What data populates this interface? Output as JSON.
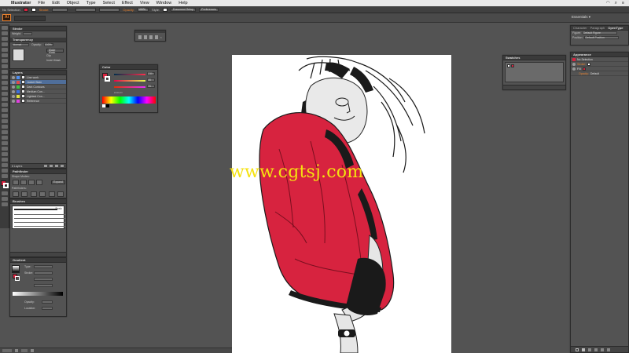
{
  "menubar": {
    "app_name": "Illustrator",
    "items": [
      "File",
      "Edit",
      "Object",
      "Type",
      "Select",
      "Effect",
      "View",
      "Window",
      "Help"
    ]
  },
  "controlbar": {
    "selection_label": "No Selection",
    "stroke_label": "Stroke:",
    "opacity_label": "Opacity:",
    "opacity_value": "100%",
    "style_label": "Style:",
    "document_setup": "Document Setup",
    "preferences": "Preferences"
  },
  "app": {
    "logo": "Ai",
    "workspace": "Essentials ▾"
  },
  "stroke_panel": {
    "title": "Stroke",
    "weight_label": "Weight:"
  },
  "transparency_panel": {
    "title": "Transparency",
    "blend_mode": "Normal",
    "opacity_label": "Opacity:",
    "opacity_value": "100%",
    "make_mask": "Make Mask",
    "clip": "Clip",
    "invert_mask": "Invert Mask"
  },
  "layers_panel": {
    "title": "Layers",
    "footer": "6 Layers",
    "layers": [
      {
        "name": "Line work",
        "color": "#4f8ff0"
      },
      {
        "name": "Jacket Stain",
        "color": "#e04a4a"
      },
      {
        "name": "Dark Contours",
        "color": "#3fc43f"
      },
      {
        "name": "Medium Con...",
        "color": "#3c6fe0"
      },
      {
        "name": "Lightest Con...",
        "color": "#e0e040"
      },
      {
        "name": "Reference",
        "color": "#e040e0"
      }
    ]
  },
  "pathfinder_panel": {
    "title": "Pathfinder",
    "shape_modes": "Shape Modes:",
    "expand": "Expand",
    "pathfinders": "Pathfinders:"
  },
  "brushes_panel": {
    "title": "Brushes",
    "basic": "Basic"
  },
  "gradient_panel": {
    "title": "Gradient",
    "type_label": "Type:",
    "stroke_label": "Stroke:",
    "opacity_label": "Opacity:",
    "location_label": "Location:"
  },
  "color_panel": {
    "title": "Color",
    "r": "230",
    "g": "46",
    "b": "76",
    "hex": "E62E4C"
  },
  "swatches_panel": {
    "title": "Swatches"
  },
  "right_tabs": {
    "tabs": [
      "Character",
      "Paragraph",
      "OpenType"
    ],
    "figure_label": "Figure:",
    "figure_value": "Default Figure",
    "position_label": "Position:",
    "position_value": "Default Position"
  },
  "appearance_panel": {
    "title": "Appearance",
    "selection": "No Selection",
    "stroke_label": "Stroke:",
    "fill_label": "Fill:",
    "opacity_label": "Opacity:",
    "opacity_value": "Default"
  },
  "watermark": "www.cgtsj.com",
  "colors": {
    "accent": "#e8812f",
    "jacket_red": "#d7233f",
    "ui_bg": "#535353",
    "panel_head": "#3a3a3a"
  },
  "icons": [
    "apple-icon",
    "eye-icon",
    "fill-swatch-icon",
    "stroke-swatch-icon",
    "pen-tool-icon",
    "selection-tool-icon"
  ]
}
